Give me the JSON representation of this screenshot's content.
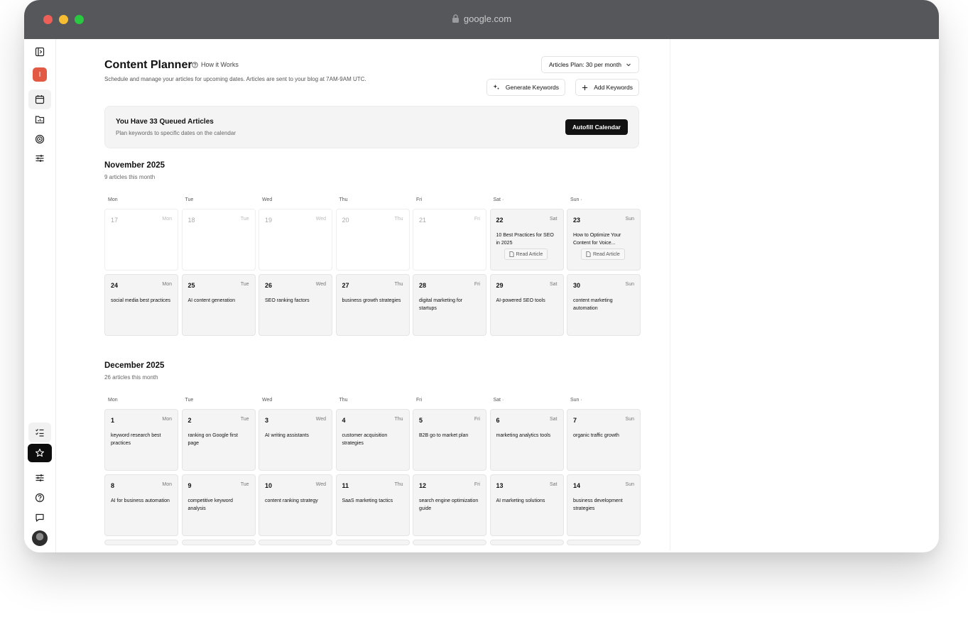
{
  "browser": {
    "url": "google.com"
  },
  "page": {
    "title": "Content Planner",
    "how_it_works": "How it Works",
    "subtitle": "Schedule and manage your articles for upcoming dates. Articles are sent to your blog at 7AM-9AM UTC.",
    "plan_select": "Articles Plan: 30 per month",
    "generate_keywords": "Generate Keywords",
    "add_keywords": "Add Keywords"
  },
  "sidebar": {
    "workspace_initial": "I"
  },
  "queue": {
    "title": "You Have 33 Queued Articles",
    "subtitle": "Plan keywords to specific dates on the calendar",
    "button": "Autofill Calendar"
  },
  "weekdays": [
    "Mon",
    "Tue",
    "Wed",
    "Thu",
    "Fri",
    "Sat ·",
    "Sun ·"
  ],
  "months": [
    {
      "title": "November 2025",
      "subtitle": "9 articles this month",
      "days": [
        {
          "num": "17",
          "name": "Mon",
          "past": true
        },
        {
          "num": "18",
          "name": "Tue",
          "past": true
        },
        {
          "num": "19",
          "name": "Wed",
          "past": true
        },
        {
          "num": "20",
          "name": "Thu",
          "past": true
        },
        {
          "num": "21",
          "name": "Fri",
          "past": true
        },
        {
          "num": "22",
          "name": "Sat",
          "topic": "10 Best Practices for SEO in 2025",
          "action": "Read Article"
        },
        {
          "num": "23",
          "name": "Sun",
          "topic": "How to Optimize Your Content for Voice...",
          "action": "Read Article"
        },
        {
          "num": "24",
          "name": "Mon",
          "topic": "social media best practices"
        },
        {
          "num": "25",
          "name": "Tue",
          "topic": "AI content generation"
        },
        {
          "num": "26",
          "name": "Wed",
          "topic": "SEO ranking factors"
        },
        {
          "num": "27",
          "name": "Thu",
          "topic": "business growth strategies"
        },
        {
          "num": "28",
          "name": "Fri",
          "topic": "digital marketing for startups"
        },
        {
          "num": "29",
          "name": "Sat",
          "topic": "AI-powered SEO tools"
        },
        {
          "num": "30",
          "name": "Sun",
          "topic": "content marketing automation"
        }
      ]
    },
    {
      "title": "December 2025",
      "subtitle": "26 articles this month",
      "days": [
        {
          "num": "1",
          "name": "Mon",
          "topic": "keyword research best practices"
        },
        {
          "num": "2",
          "name": "Tue",
          "topic": "ranking on Google first page"
        },
        {
          "num": "3",
          "name": "Wed",
          "topic": "AI writing assistants"
        },
        {
          "num": "4",
          "name": "Thu",
          "topic": "customer acquisition strategies"
        },
        {
          "num": "5",
          "name": "Fri",
          "topic": "B2B go to market plan"
        },
        {
          "num": "6",
          "name": "Sat",
          "topic": "marketing analytics tools"
        },
        {
          "num": "7",
          "name": "Sun",
          "topic": "organic traffic growth"
        },
        {
          "num": "8",
          "name": "Mon",
          "topic": "AI for business automation"
        },
        {
          "num": "9",
          "name": "Tue",
          "topic": "competitive keyword analysis"
        },
        {
          "num": "10",
          "name": "Wed",
          "topic": "content ranking strategy"
        },
        {
          "num": "11",
          "name": "Thu",
          "topic": "SaaS marketing tactics"
        },
        {
          "num": "12",
          "name": "Fri",
          "topic": "search engine optimization guide"
        },
        {
          "num": "13",
          "name": "Sat",
          "topic": "AI marketing solutions"
        },
        {
          "num": "14",
          "name": "Sun",
          "topic": "business development strategies"
        }
      ]
    }
  ]
}
